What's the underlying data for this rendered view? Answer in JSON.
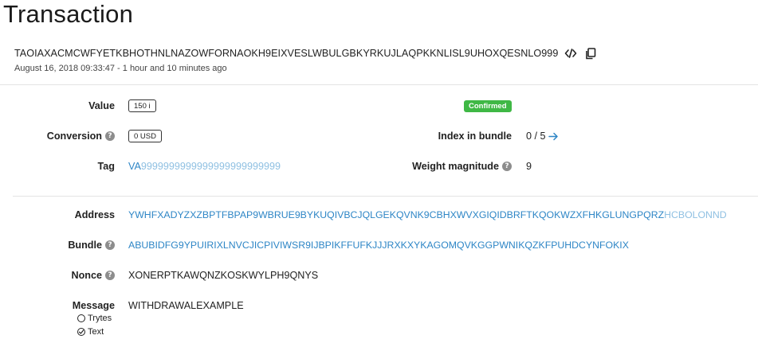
{
  "page": {
    "title": "Transaction"
  },
  "transaction": {
    "hash": "TAOIAXACMCWFYETKBHOTHNLNAZOWFORNAOKH9EIXVESLWBULGBKYRKUJLAQPKKNLISL9UHOXQESNLO999",
    "timestamp": "August 16, 2018 09:33:47 - 1 hour and 10 minutes ago"
  },
  "fields": {
    "value_label": "Value",
    "value": "150 i",
    "status": "Confirmed",
    "conversion_label": "Conversion",
    "conversion": "0 USD",
    "index_label": "Index in bundle",
    "index": "0 / 5",
    "tag_label": "Tag",
    "tag_prefix": "VA",
    "tag_suffix": "9999999999999999999999999",
    "weight_label": "Weight magnitude",
    "weight": "9",
    "address_label": "Address",
    "address_main": "YWHFXADYZXZBPTFBPAP9WBRUE9BYKUQIVBCJQLGEKQVNK9CBHXWVXGIQIDBRFTKQOKWZXFHKGLUNGPQRZ",
    "address_checksum": "HCBOLONND",
    "bundle_label": "Bundle",
    "bundle": "ABUBIDFG9YPUIRIXLNVCJICPIVIWSR9IJBPIKFFUFKJJJRXKXYKAGOMQVKGGPWNIKQZKFPUHDCYNFOKIX",
    "nonce_label": "Nonce",
    "nonce": "XONERPTKAWQNZKOSKWYLPH9QNYS",
    "message_label": "Message",
    "message": "WITHDRAWALEXAMPLE",
    "option_trytes": "Trytes",
    "option_text": "Text"
  },
  "icons": {
    "code": "code-icon",
    "copy": "copy-icon",
    "help": "question-circle-icon",
    "arrow": "arrow-right-icon",
    "radio_empty": "radio-unchecked-icon",
    "radio_checked": "radio-checked-icon"
  },
  "colors": {
    "link": "#2e86c6",
    "link_light": "#8fc0e2",
    "confirmed": "#3fb845"
  }
}
